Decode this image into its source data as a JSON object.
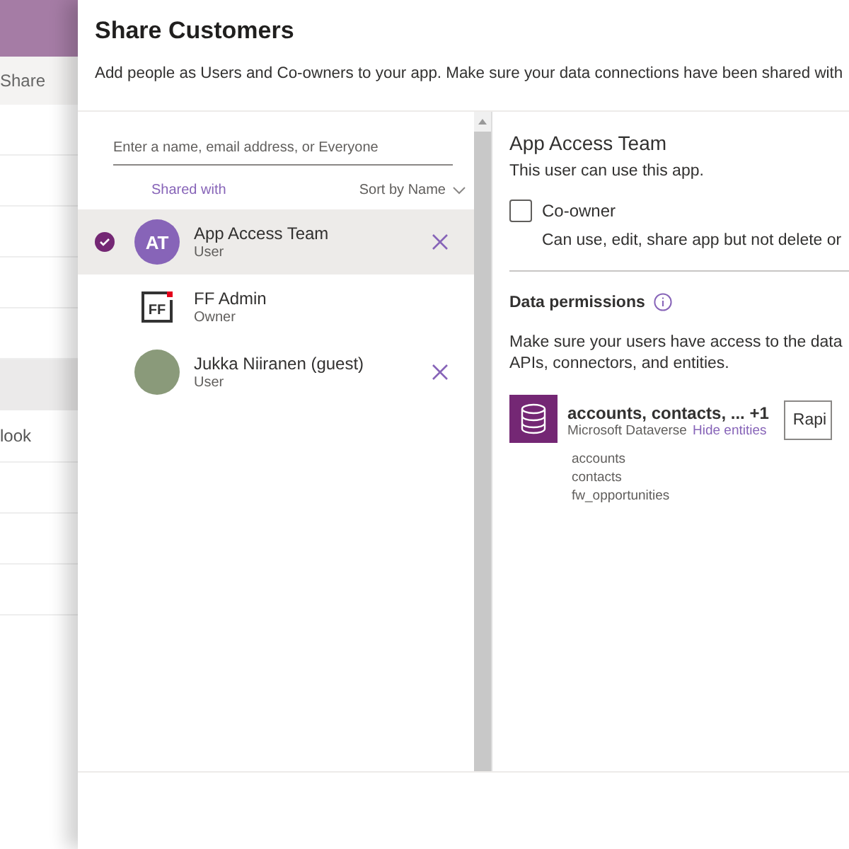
{
  "background_app": {
    "toolbar_label": "Share",
    "list_item": "look"
  },
  "panel": {
    "title": "Share Customers",
    "description": "Add people as Users and Co-owners to your app. Make sure your data connections have been shared with"
  },
  "search": {
    "placeholder": "Enter a name, email address, or Everyone"
  },
  "list_header": {
    "shared_with": "Shared with",
    "sort": "Sort by Name"
  },
  "people": [
    {
      "name": "App Access Team",
      "role": "User",
      "selected": true,
      "removable": true,
      "avatar": {
        "kind": "initials",
        "text": "AT",
        "color": "#8764b8"
      }
    },
    {
      "name": "FF Admin",
      "role": "Owner",
      "selected": false,
      "removable": false,
      "avatar": {
        "kind": "logo",
        "text": "FF"
      }
    },
    {
      "name": "Jukka Niiranen (guest)",
      "role": "User",
      "selected": false,
      "removable": true,
      "avatar": {
        "kind": "photo"
      }
    }
  ],
  "detail": {
    "title": "App Access Team",
    "subtitle": "This user can use this app.",
    "coowner": {
      "label": "Co-owner",
      "checked": false,
      "description": "Can use, edit, share app but not delete or"
    },
    "data_permissions": {
      "title": "Data permissions",
      "description": "Make sure your users have access to the data",
      "description_2": "APIs, connectors, and entities."
    },
    "data_source": {
      "name": "accounts, contacts, ... +1",
      "provider": "Microsoft Dataverse",
      "link": "Hide entities",
      "dropdown": "Rapi",
      "entities": [
        "accounts",
        "contacts",
        "fw_opportunities"
      ]
    }
  }
}
